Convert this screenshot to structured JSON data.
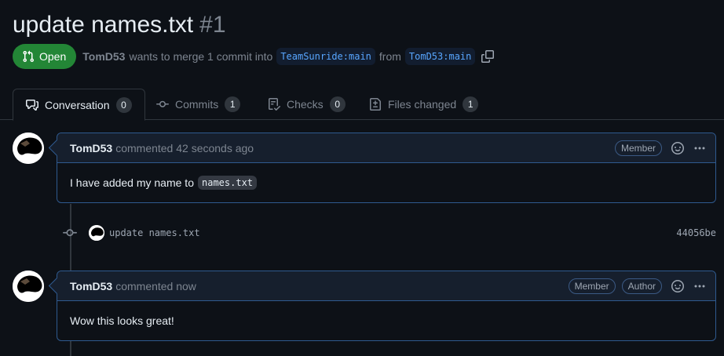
{
  "pr": {
    "title": "update names.txt",
    "number": "#1",
    "state": "Open",
    "author": "TomD53",
    "merge_text": "wants to merge 1 commit into",
    "base_branch": "TeamSunride:main",
    "from_text": "from",
    "head_branch": "TomD53:main"
  },
  "tabs": [
    {
      "label": "Conversation",
      "count": "0",
      "icon": "comment-discussion-icon"
    },
    {
      "label": "Commits",
      "count": "1",
      "icon": "git-commit-icon"
    },
    {
      "label": "Checks",
      "count": "0",
      "icon": "checklist-icon"
    },
    {
      "label": "Files changed",
      "count": "1",
      "icon": "file-diff-icon"
    }
  ],
  "comments": [
    {
      "author": "TomD53",
      "time": "commented 42 seconds ago",
      "badges": [
        "Member"
      ],
      "body_text": "I have added my name to",
      "body_code": "names.txt"
    },
    {
      "author": "TomD53",
      "time": "commented now",
      "badges": [
        "Member",
        "Author"
      ],
      "body_text": "Wow this looks great!"
    }
  ],
  "commit": {
    "message": "update names.txt",
    "sha": "44056be"
  },
  "colors": {
    "background": "#0d1117",
    "open_green": "#238636",
    "link_blue": "#58a6ff",
    "comment_border": "#2f5a8f"
  }
}
